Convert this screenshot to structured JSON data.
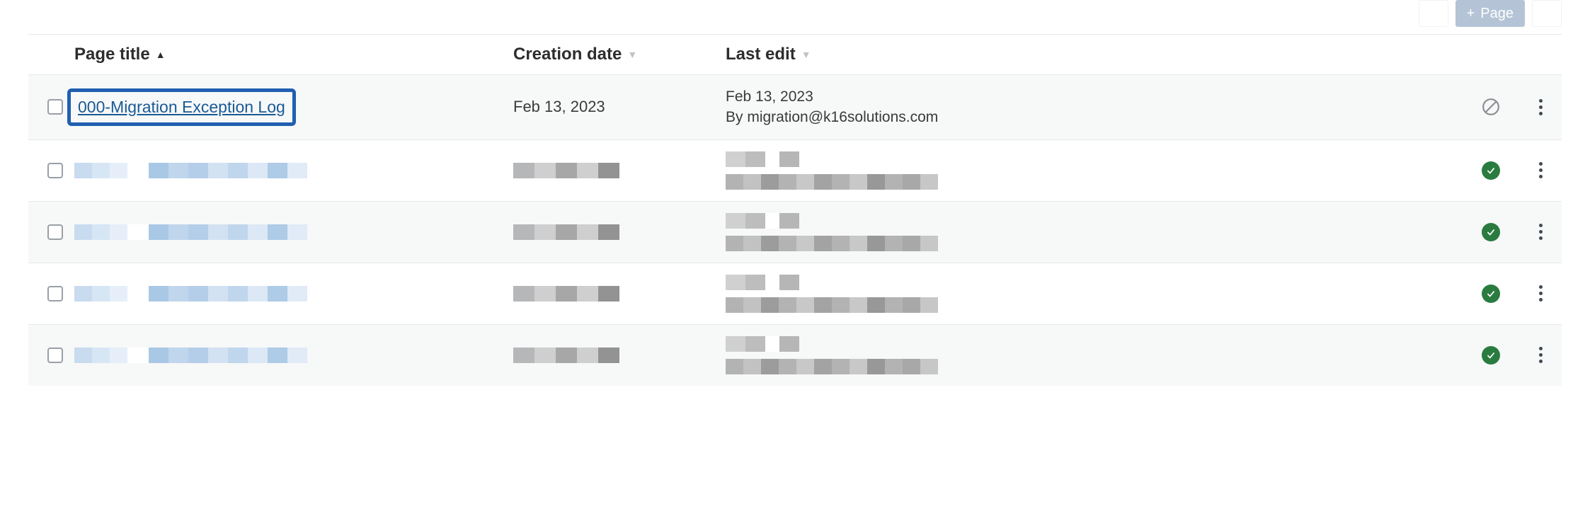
{
  "toolbar": {
    "page_button_label": "Page"
  },
  "columns": {
    "title": "Page title",
    "creation": "Creation date",
    "edit": "Last edit"
  },
  "rows": [
    {
      "title": "000-Migration Exception Log",
      "creation": "Feb 13, 2023",
      "edit_date": "Feb 13, 2023",
      "edit_by": "By migration@k16solutions.com",
      "status": "unpublished",
      "highlighted": true,
      "redacted": false
    },
    {
      "redacted": true,
      "status": "published"
    },
    {
      "redacted": true,
      "status": "published"
    },
    {
      "redacted": true,
      "status": "published"
    },
    {
      "redacted": true,
      "status": "published"
    }
  ]
}
